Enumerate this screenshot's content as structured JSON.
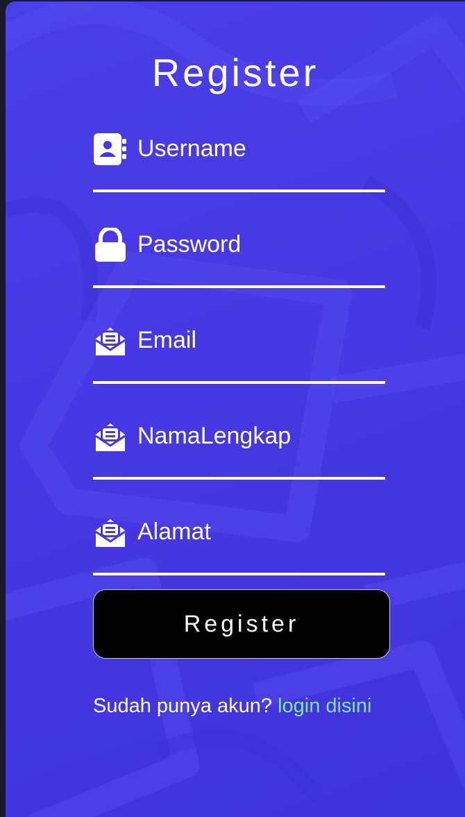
{
  "header": {
    "title": "Register"
  },
  "form": {
    "fields": [
      {
        "key": "username",
        "placeholder": "Username",
        "icon": "contact-card-icon"
      },
      {
        "key": "password",
        "placeholder": "Password",
        "icon": "lock-icon"
      },
      {
        "key": "email",
        "placeholder": "Email",
        "icon": "envelope-open-icon"
      },
      {
        "key": "namalengkap",
        "placeholder": "NamaLengkap",
        "icon": "envelope-open-icon"
      },
      {
        "key": "alamat",
        "placeholder": "Alamat",
        "icon": "envelope-open-icon"
      }
    ],
    "submit_label": "Register"
  },
  "footer": {
    "prompt": "Sudah punya akun?",
    "link_label": "login disini"
  },
  "colors": {
    "background": "#4638e4",
    "text": "#ffffff",
    "link": "#7ee6b0",
    "button": "#000000"
  }
}
